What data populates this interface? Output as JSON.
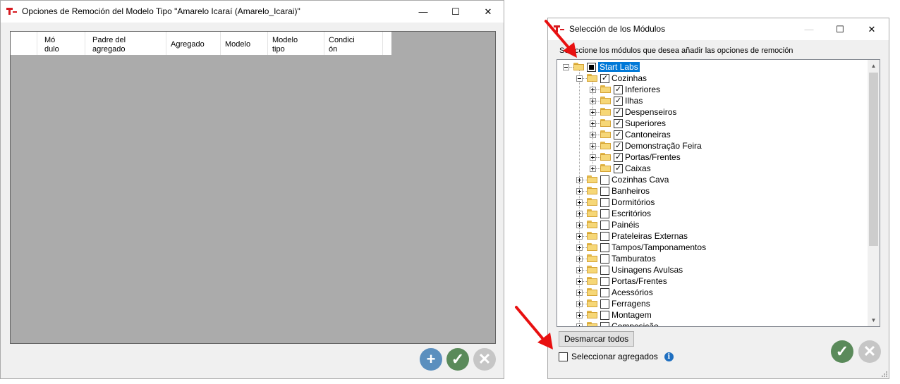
{
  "window1": {
    "title": "Opciones de Remoción del Modelo Tipo \"Amarelo Icaraí (Amarelo_Icarai)\"",
    "caption": {
      "minimize": "—",
      "maximize": "☐",
      "close": "✕"
    },
    "grid_columns": [
      "Mó\ndulo",
      "Padre del\nagregado",
      "Agregado",
      "Modelo",
      "Modelo\ntipo",
      "Condici\nón"
    ],
    "buttons": {
      "add": "+",
      "confirm": "✓",
      "cancel": "✕"
    }
  },
  "window2": {
    "title": "Selección de los Módulos",
    "caption": {
      "minimize": "—",
      "maximize": "☐",
      "close": "✕"
    },
    "instruction": "Seleccione los módulos que desea añadir las opciones de remoción",
    "tree": [
      {
        "label": "Start Labs",
        "level": 0,
        "state": "partial",
        "expander": "minus",
        "selected": true
      },
      {
        "label": "Cozinhas",
        "level": 1,
        "state": "checked",
        "expander": "minus"
      },
      {
        "label": "Inferiores",
        "level": 2,
        "state": "checked",
        "expander": "plus"
      },
      {
        "label": "Ilhas",
        "level": 2,
        "state": "checked",
        "expander": "plus"
      },
      {
        "label": "Despenseiros",
        "level": 2,
        "state": "checked",
        "expander": "plus"
      },
      {
        "label": "Superiores",
        "level": 2,
        "state": "checked",
        "expander": "plus"
      },
      {
        "label": "Cantoneiras",
        "level": 2,
        "state": "checked",
        "expander": "plus"
      },
      {
        "label": "Demonstração Feira",
        "level": 2,
        "state": "checked",
        "expander": "plus"
      },
      {
        "label": "Portas/Frentes",
        "level": 2,
        "state": "checked",
        "expander": "plus"
      },
      {
        "label": "Caixas",
        "level": 2,
        "state": "checked",
        "expander": "plus"
      },
      {
        "label": "Cozinhas Cava",
        "level": 1,
        "state": "unchecked",
        "expander": "plus"
      },
      {
        "label": "Banheiros",
        "level": 1,
        "state": "unchecked",
        "expander": "plus"
      },
      {
        "label": "Dormitórios",
        "level": 1,
        "state": "unchecked",
        "expander": "plus"
      },
      {
        "label": "Escritórios",
        "level": 1,
        "state": "unchecked",
        "expander": "plus"
      },
      {
        "label": "Painéis",
        "level": 1,
        "state": "unchecked",
        "expander": "plus"
      },
      {
        "label": "Prateleiras Externas",
        "level": 1,
        "state": "unchecked",
        "expander": "plus"
      },
      {
        "label": "Tampos/Tamponamentos",
        "level": 1,
        "state": "unchecked",
        "expander": "plus"
      },
      {
        "label": "Tamburatos",
        "level": 1,
        "state": "unchecked",
        "expander": "plus"
      },
      {
        "label": "Usinagens Avulsas",
        "level": 1,
        "state": "unchecked",
        "expander": "plus"
      },
      {
        "label": "Portas/Frentes",
        "level": 1,
        "state": "unchecked",
        "expander": "plus"
      },
      {
        "label": "Acessórios",
        "level": 1,
        "state": "unchecked",
        "expander": "plus"
      },
      {
        "label": "Ferragens",
        "level": 1,
        "state": "unchecked",
        "expander": "plus"
      },
      {
        "label": "Montagem",
        "level": 1,
        "state": "unchecked",
        "expander": "plus"
      },
      {
        "label": "Composição",
        "level": 1,
        "state": "unchecked",
        "expander": "plus"
      }
    ],
    "scroll": {
      "up": "▲",
      "down": "▼"
    },
    "unmark_all_label": "Desmarcar todos",
    "select_aggregates_label": "Seleccionar agregados",
    "info": "i",
    "buttons": {
      "confirm": "✓",
      "cancel": "✕"
    }
  },
  "colors": {
    "accent_blue": "#5b8fbe",
    "confirm_green": "#5a8a5a",
    "disabled_gray": "#c6c6c6",
    "annotation_red": "#e81010",
    "selection_blue": "#0078d7"
  },
  "icons": [
    "app-logo",
    "folder-icon",
    "plus-circle-icon",
    "check-circle-icon",
    "close-circle-icon",
    "info-icon",
    "red-arrow-annotation"
  ]
}
